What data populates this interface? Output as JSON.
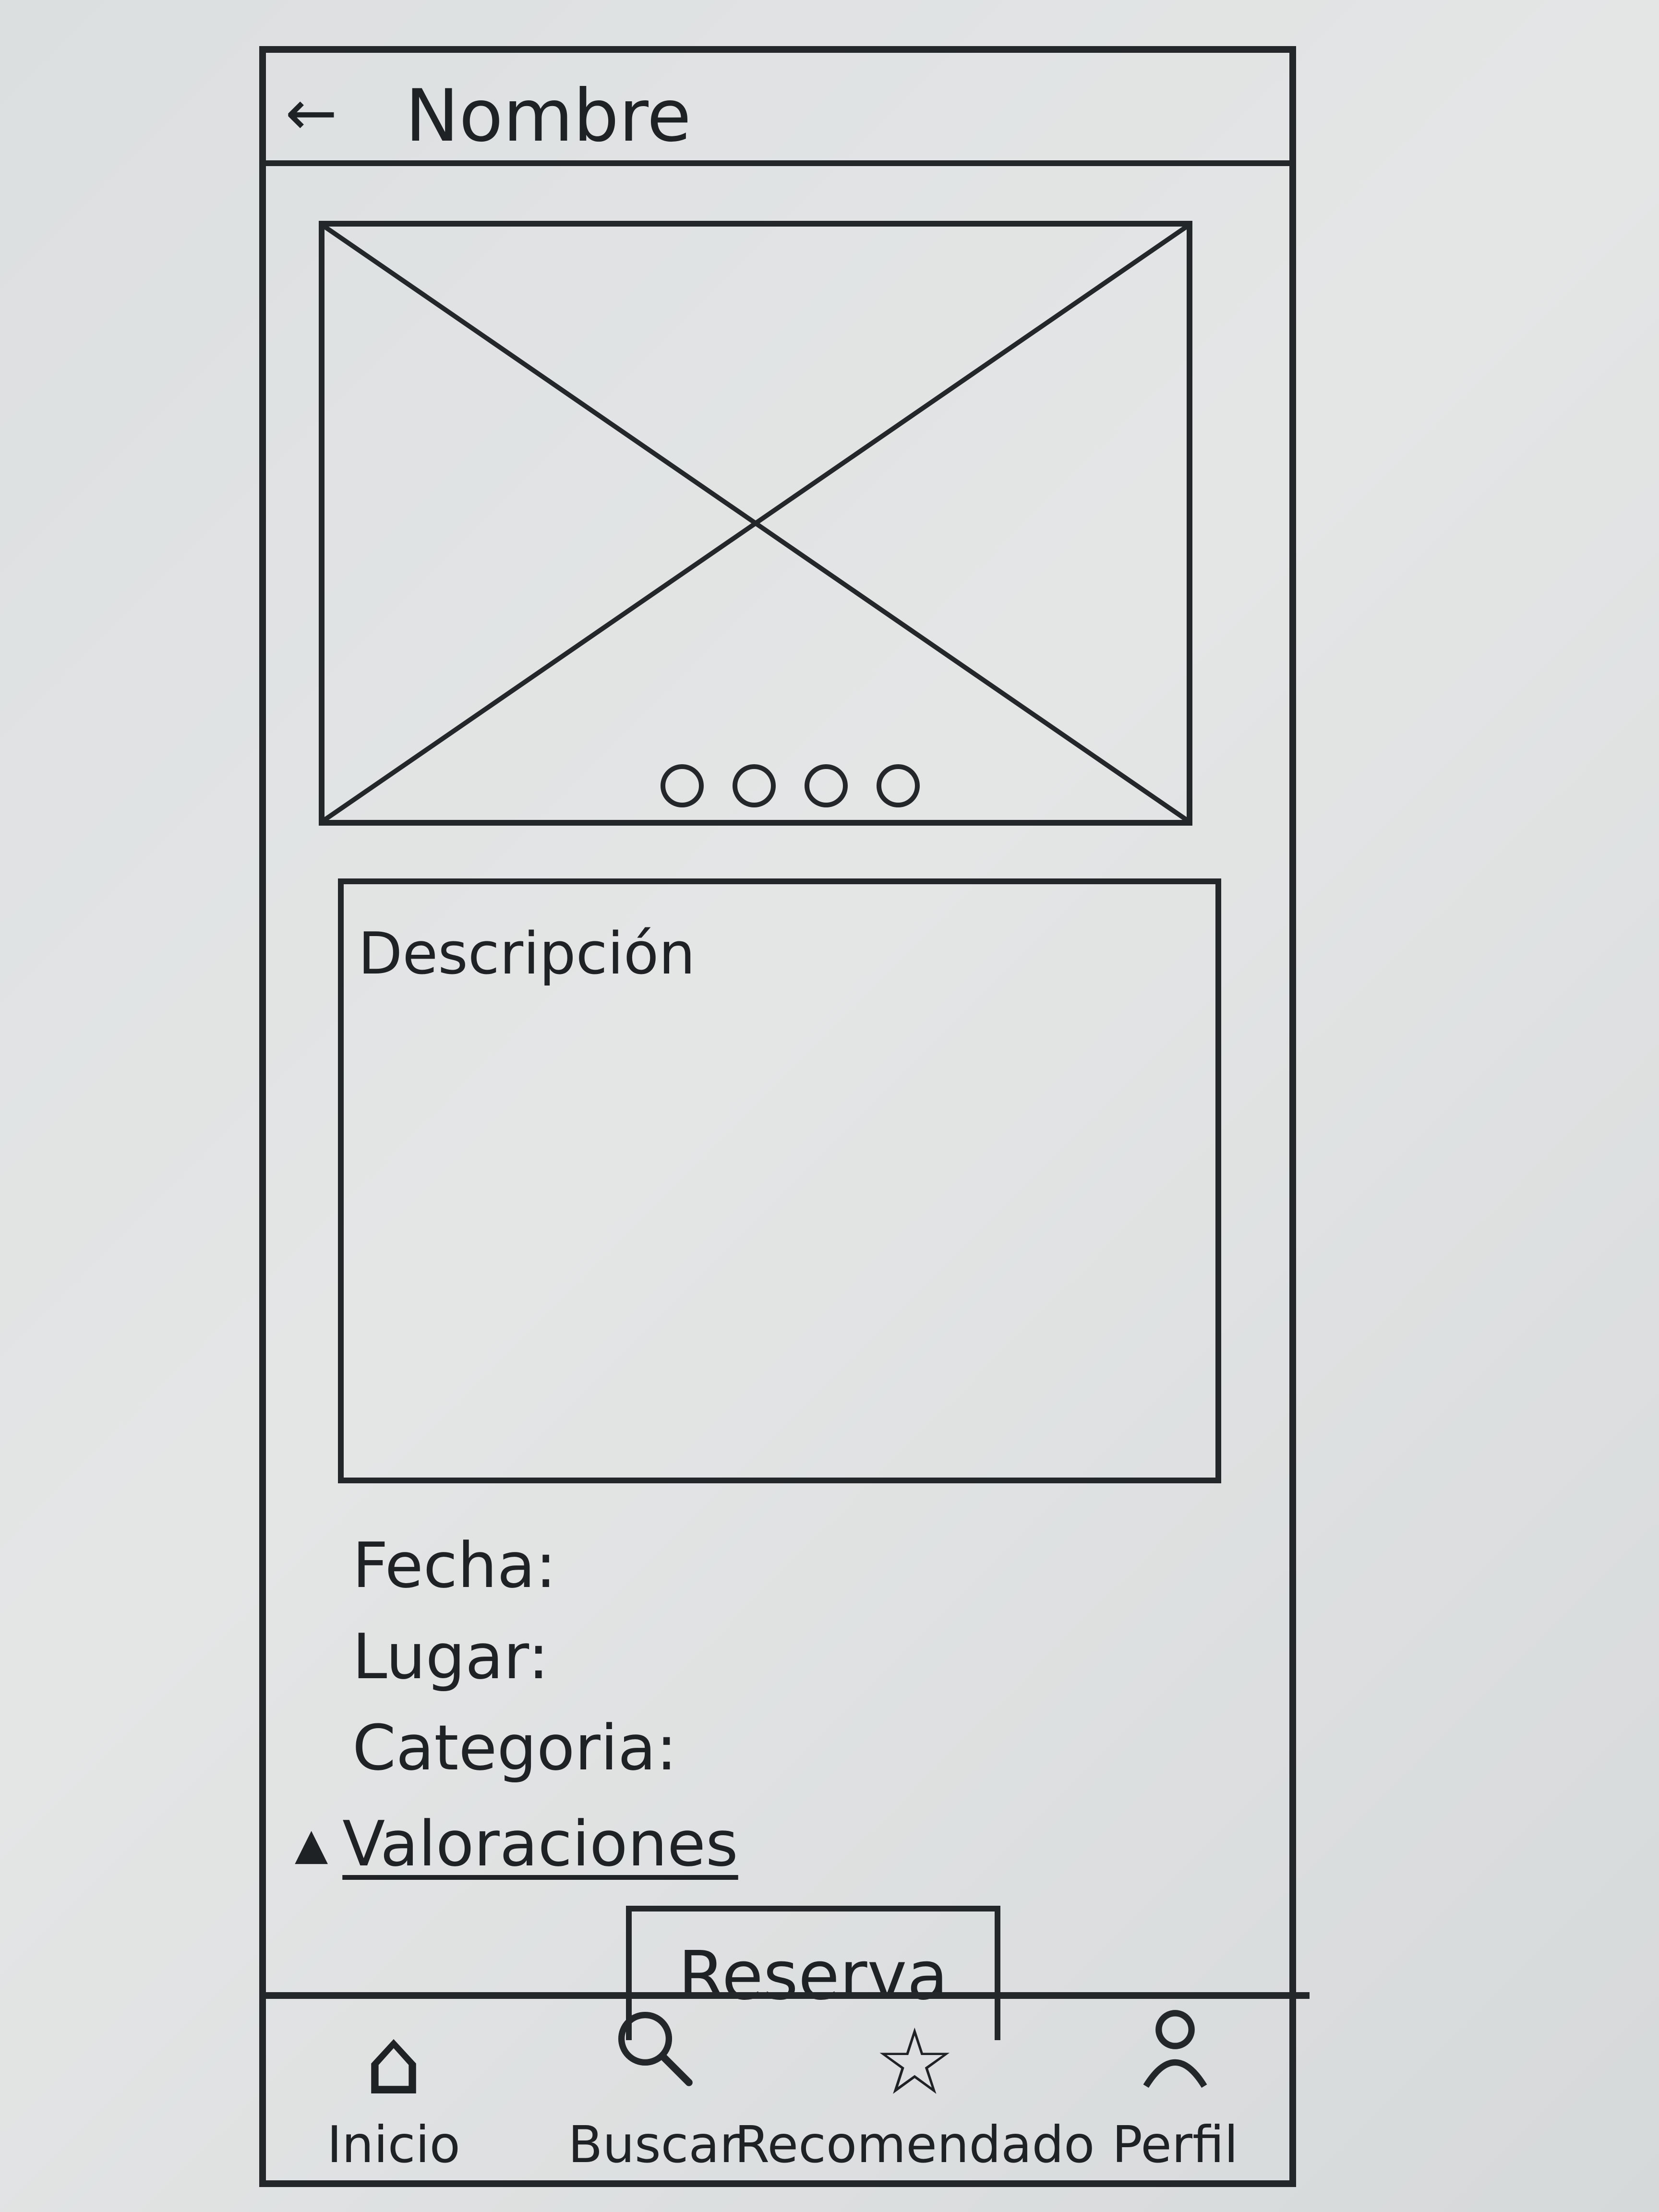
{
  "header": {
    "back_icon": "←",
    "title": "Nombre"
  },
  "carousel": {
    "dots": 4
  },
  "description": {
    "label": "Descripción"
  },
  "fields": {
    "fecha": "Fecha:",
    "lugar": "Lugar:",
    "categoria": "Categoria:"
  },
  "ratings": {
    "label": "Valoraciones"
  },
  "reserve": {
    "label": "Reserva"
  },
  "tabbar": {
    "items": [
      {
        "label": "Inicio",
        "icon": "home-icon"
      },
      {
        "label": "Buscar",
        "icon": "search-icon"
      },
      {
        "label": "Recomendado",
        "icon": "star-icon"
      },
      {
        "label": "Perfil",
        "icon": "user-icon"
      }
    ]
  }
}
